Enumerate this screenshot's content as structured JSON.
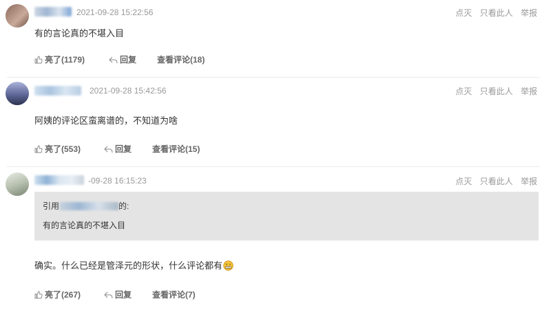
{
  "actions": {
    "like": "点灭",
    "only_view": "只看此人",
    "report": "举报"
  },
  "footer_labels": {
    "like_prefix": "亮了",
    "reply": "回复",
    "view_replies_prefix": "查看评论"
  },
  "comments": [
    {
      "time": "2021-09-28 15:22:56",
      "content": "有的言论真的不堪入目",
      "like_count": "亮了(1179)",
      "reply": "回复",
      "view": "查看评论(18)"
    },
    {
      "time": "2021-09-28 15:42:56",
      "content": "阿姨的评论区蛮离谱的，不知道为啥",
      "like_count": "亮了(553)",
      "reply": "回复",
      "view": "查看评论(15)"
    },
    {
      "time": "-09-28 16:15:23",
      "quote_prefix": "引用",
      "quote_suffix": "的:",
      "quote_text": "有的言论真的不堪入目",
      "content": "确实。什么已经是管泽元的形状，什么评论都有",
      "like_count": "亮了(267)",
      "reply": "回复",
      "view": "查看评论(7)"
    }
  ],
  "icons": {
    "like": "thumb-icon",
    "reply": "reply-arrow-icon",
    "emoji": "grimace-emoji-icon"
  }
}
